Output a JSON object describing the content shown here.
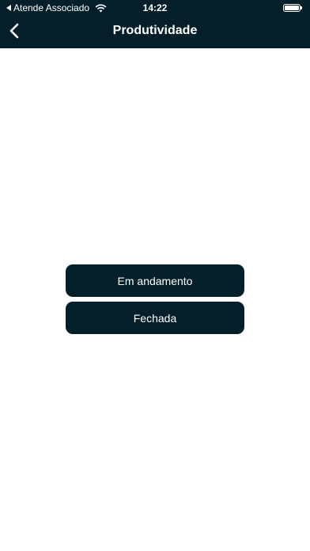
{
  "status_bar": {
    "carrier": "Atende Associado",
    "time": "14:22",
    "icons": [
      "back-to-app-icon",
      "wifi-icon",
      "battery-icon"
    ]
  },
  "header": {
    "title": "Produtividade",
    "back_icon": "chevron-left-icon"
  },
  "buttons": [
    {
      "label": "Em andamento"
    },
    {
      "label": "Fechada"
    }
  ],
  "colors": {
    "primary": "#03202a",
    "background": "#ffffff",
    "text_on_primary": "#ffffff"
  }
}
